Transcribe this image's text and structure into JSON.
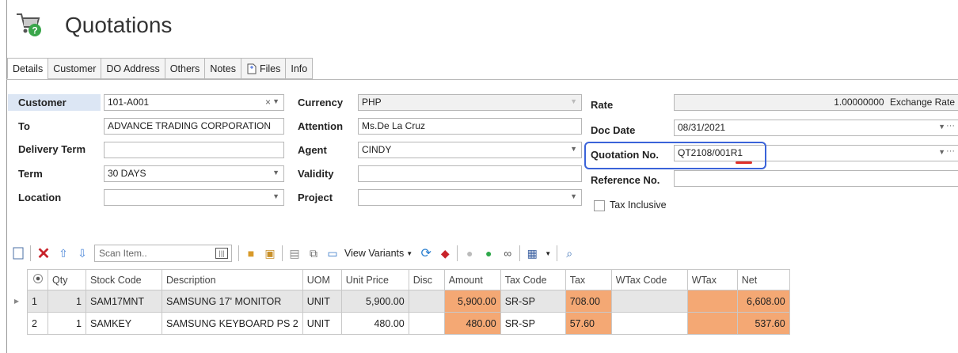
{
  "window": {
    "title": "Quotations"
  },
  "tabs": [
    "Details",
    "Customer",
    "DO Address",
    "Others",
    "Notes",
    "Files",
    "Info"
  ],
  "form": {
    "customer_label": "Customer",
    "customer_value": "101-A001",
    "to_label": "To",
    "to_value": "ADVANCE TRADING CORPORATION",
    "delivery_label": "Delivery Term",
    "delivery_value": "",
    "term_label": "Term",
    "term_value": "30 DAYS",
    "location_label": "Location",
    "location_value": "",
    "currency_label": "Currency",
    "currency_value": "PHP",
    "attention_label": "Attention",
    "attention_value": "Ms.De La Cruz",
    "agent_label": "Agent",
    "agent_value": "CINDY",
    "validity_label": "Validity",
    "validity_value": "",
    "project_label": "Project",
    "project_value": "",
    "rate_label": "Rate",
    "rate_value": "1.00000000",
    "rate_suffix": "Exchange Rate",
    "docdate_label": "Doc Date",
    "docdate_value": "08/31/2021",
    "quotno_label": "Quotation No.",
    "quotno_value": "QT2108/001R1",
    "refno_label": "Reference No.",
    "refno_value": "",
    "taxinc_label": "Tax Inclusive"
  },
  "toolbar": {
    "scan_placeholder": "Scan Item..",
    "variants_label": "View Variants"
  },
  "grid": {
    "columns": [
      "Qty",
      "Stock Code",
      "Description",
      "UOM",
      "Unit Price",
      "Disc",
      "Amount",
      "Tax Code",
      "Tax",
      "WTax Code",
      "WTax",
      "Net"
    ],
    "rows": [
      {
        "no": "1",
        "qty": "1",
        "code": "SAM17MNT",
        "desc": "SAMSUNG 17' MONITOR",
        "uom": "UNIT",
        "price": "5,900.00",
        "disc": "",
        "amount": "5,900.00",
        "taxcode": "SR-SP",
        "tax": "708.00",
        "wtaxcode": "",
        "wtax": "",
        "net": "6,608.00"
      },
      {
        "no": "2",
        "qty": "1",
        "code": "SAMKEY",
        "desc": "SAMSUNG KEYBOARD PS 2",
        "uom": "UNIT",
        "price": "480.00",
        "disc": "",
        "amount": "480.00",
        "taxcode": "SR-SP",
        "tax": "57.60",
        "wtaxcode": "",
        "wtax": "",
        "net": "537.60"
      }
    ]
  },
  "colors": {
    "highlight": "#3a63d9",
    "orange_cell": "#f4a874",
    "underline": "#e0302a"
  }
}
